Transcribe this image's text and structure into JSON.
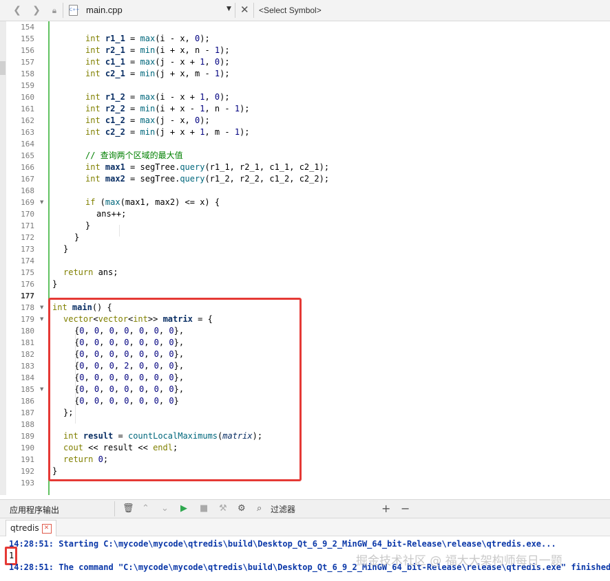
{
  "toolbar": {
    "back_icon": "back-arrow-icon",
    "forward_icon": "forward-arrow-icon",
    "lock_icon": "lock-icon",
    "file_icon": "cpp-file-icon",
    "file_name": "main.cpp",
    "symbol_placeholder": "<Select Symbol>"
  },
  "editor": {
    "lines": [
      {
        "n": "154",
        "fold": false
      },
      {
        "n": "155",
        "fold": false
      },
      {
        "n": "156",
        "fold": false
      },
      {
        "n": "157",
        "fold": false
      },
      {
        "n": "158",
        "fold": false
      },
      {
        "n": "159",
        "fold": false
      },
      {
        "n": "160",
        "fold": false
      },
      {
        "n": "161",
        "fold": false
      },
      {
        "n": "162",
        "fold": false
      },
      {
        "n": "163",
        "fold": false
      },
      {
        "n": "164",
        "fold": false
      },
      {
        "n": "165",
        "fold": false
      },
      {
        "n": "166",
        "fold": false
      },
      {
        "n": "167",
        "fold": false
      },
      {
        "n": "168",
        "fold": false
      },
      {
        "n": "169",
        "fold": true
      },
      {
        "n": "170",
        "fold": false
      },
      {
        "n": "171",
        "fold": false
      },
      {
        "n": "172",
        "fold": false
      },
      {
        "n": "173",
        "fold": false
      },
      {
        "n": "174",
        "fold": false
      },
      {
        "n": "175",
        "fold": false
      },
      {
        "n": "176",
        "fold": false
      },
      {
        "n": "177",
        "fold": false,
        "current": true
      },
      {
        "n": "178",
        "fold": true
      },
      {
        "n": "179",
        "fold": true
      },
      {
        "n": "180",
        "fold": false
      },
      {
        "n": "181",
        "fold": false
      },
      {
        "n": "182",
        "fold": false
      },
      {
        "n": "183",
        "fold": false
      },
      {
        "n": "184",
        "fold": false
      },
      {
        "n": "185",
        "fold": true
      },
      {
        "n": "186",
        "fold": false
      },
      {
        "n": "187",
        "fold": false
      },
      {
        "n": "188",
        "fold": false
      },
      {
        "n": "189",
        "fold": false
      },
      {
        "n": "190",
        "fold": false
      },
      {
        "n": "191",
        "fold": false
      },
      {
        "n": "192",
        "fold": false
      },
      {
        "n": "193",
        "fold": false
      }
    ],
    "code": [
      [],
      [
        [
          "kw",
          "int"
        ],
        [
          "t",
          " "
        ],
        [
          "var",
          "r1_1"
        ],
        [
          "t",
          " = "
        ],
        [
          "fn",
          "max"
        ],
        [
          "t",
          "(i - x, "
        ],
        [
          "num",
          "0"
        ],
        [
          "t",
          ");"
        ]
      ],
      [
        [
          "kw",
          "int"
        ],
        [
          "t",
          " "
        ],
        [
          "var",
          "r2_1"
        ],
        [
          "t",
          " = "
        ],
        [
          "fn",
          "min"
        ],
        [
          "t",
          "(i + x, n - "
        ],
        [
          "num",
          "1"
        ],
        [
          "t",
          ");"
        ]
      ],
      [
        [
          "kw",
          "int"
        ],
        [
          "t",
          " "
        ],
        [
          "var",
          "c1_1"
        ],
        [
          "t",
          " = "
        ],
        [
          "fn",
          "max"
        ],
        [
          "t",
          "(j - x + "
        ],
        [
          "num",
          "1"
        ],
        [
          "t",
          ", "
        ],
        [
          "num",
          "0"
        ],
        [
          "t",
          ");"
        ]
      ],
      [
        [
          "kw",
          "int"
        ],
        [
          "t",
          " "
        ],
        [
          "var",
          "c2_1"
        ],
        [
          "t",
          " = "
        ],
        [
          "fn",
          "min"
        ],
        [
          "t",
          "(j + x, m - "
        ],
        [
          "num",
          "1"
        ],
        [
          "t",
          ");"
        ]
      ],
      [],
      [
        [
          "kw",
          "int"
        ],
        [
          "t",
          " "
        ],
        [
          "var",
          "r1_2"
        ],
        [
          "t",
          " = "
        ],
        [
          "fn",
          "max"
        ],
        [
          "t",
          "(i - x + "
        ],
        [
          "num",
          "1"
        ],
        [
          "t",
          ", "
        ],
        [
          "num",
          "0"
        ],
        [
          "t",
          ");"
        ]
      ],
      [
        [
          "kw",
          "int"
        ],
        [
          "t",
          " "
        ],
        [
          "var",
          "r2_2"
        ],
        [
          "t",
          " = "
        ],
        [
          "fn",
          "min"
        ],
        [
          "t",
          "(i + x - "
        ],
        [
          "num",
          "1"
        ],
        [
          "t",
          ", n - "
        ],
        [
          "num",
          "1"
        ],
        [
          "t",
          ");"
        ]
      ],
      [
        [
          "kw",
          "int"
        ],
        [
          "t",
          " "
        ],
        [
          "var",
          "c1_2"
        ],
        [
          "t",
          " = "
        ],
        [
          "fn",
          "max"
        ],
        [
          "t",
          "(j - x, "
        ],
        [
          "num",
          "0"
        ],
        [
          "t",
          ");"
        ]
      ],
      [
        [
          "kw",
          "int"
        ],
        [
          "t",
          " "
        ],
        [
          "var",
          "c2_2"
        ],
        [
          "t",
          " = "
        ],
        [
          "fn",
          "min"
        ],
        [
          "t",
          "(j + x + "
        ],
        [
          "num",
          "1"
        ],
        [
          "t",
          ", m - "
        ],
        [
          "num",
          "1"
        ],
        [
          "t",
          ");"
        ]
      ],
      [],
      [
        [
          "cm",
          "// 查询两个区域的最大值"
        ]
      ],
      [
        [
          "kw",
          "int"
        ],
        [
          "t",
          " "
        ],
        [
          "var",
          "max1"
        ],
        [
          "t",
          " = segTree."
        ],
        [
          "fn",
          "query"
        ],
        [
          "t",
          "(r1_1, r2_1, c1_1, c2_1);"
        ]
      ],
      [
        [
          "kw",
          "int"
        ],
        [
          "t",
          " "
        ],
        [
          "var",
          "max2"
        ],
        [
          "t",
          " = segTree."
        ],
        [
          "fn",
          "query"
        ],
        [
          "t",
          "(r1_2, r2_2, c1_2, c2_2);"
        ]
      ],
      [],
      [
        [
          "kw",
          "if"
        ],
        [
          "t",
          " ("
        ],
        [
          "fn",
          "max"
        ],
        [
          "t",
          "(max1, max2) <= x) {"
        ]
      ],
      [
        [
          "t",
          "ans++;"
        ]
      ],
      [
        [
          "t",
          "}"
        ]
      ],
      [
        [
          "t",
          "}"
        ]
      ],
      [
        [
          "t",
          "}"
        ]
      ],
      [],
      [
        [
          "kw",
          "return"
        ],
        [
          "t",
          " ans;"
        ]
      ],
      [
        [
          "t",
          "}"
        ]
      ],
      [],
      [
        [
          "kw",
          "int"
        ],
        [
          "t",
          " "
        ],
        [
          "var",
          "main"
        ],
        [
          "t",
          "() {"
        ]
      ],
      [
        [
          "kw",
          "vector"
        ],
        [
          "t",
          "<"
        ],
        [
          "kw",
          "vector"
        ],
        [
          "t",
          "<"
        ],
        [
          "kw",
          "int"
        ],
        [
          "t",
          ">> "
        ],
        [
          "var",
          "matrix"
        ],
        [
          "t",
          " = {"
        ]
      ],
      [
        [
          "t",
          "{"
        ],
        [
          "num",
          "0"
        ],
        [
          "t",
          ", "
        ],
        [
          "num",
          "0"
        ],
        [
          "t",
          ", "
        ],
        [
          "num",
          "0"
        ],
        [
          "t",
          ", "
        ],
        [
          "num",
          "0"
        ],
        [
          "t",
          ", "
        ],
        [
          "num",
          "0"
        ],
        [
          "t",
          ", "
        ],
        [
          "num",
          "0"
        ],
        [
          "t",
          ", "
        ],
        [
          "num",
          "0"
        ],
        [
          "t",
          "},"
        ]
      ],
      [
        [
          "t",
          "{"
        ],
        [
          "num",
          "0"
        ],
        [
          "t",
          ", "
        ],
        [
          "num",
          "0"
        ],
        [
          "t",
          ", "
        ],
        [
          "num",
          "0"
        ],
        [
          "t",
          ", "
        ],
        [
          "num",
          "0"
        ],
        [
          "t",
          ", "
        ],
        [
          "num",
          "0"
        ],
        [
          "t",
          ", "
        ],
        [
          "num",
          "0"
        ],
        [
          "t",
          ", "
        ],
        [
          "num",
          "0"
        ],
        [
          "t",
          "},"
        ]
      ],
      [
        [
          "t",
          "{"
        ],
        [
          "num",
          "0"
        ],
        [
          "t",
          ", "
        ],
        [
          "num",
          "0"
        ],
        [
          "t",
          ", "
        ],
        [
          "num",
          "0"
        ],
        [
          "t",
          ", "
        ],
        [
          "num",
          "0"
        ],
        [
          "t",
          ", "
        ],
        [
          "num",
          "0"
        ],
        [
          "t",
          ", "
        ],
        [
          "num",
          "0"
        ],
        [
          "t",
          ", "
        ],
        [
          "num",
          "0"
        ],
        [
          "t",
          "},"
        ]
      ],
      [
        [
          "t",
          "{"
        ],
        [
          "num",
          "0"
        ],
        [
          "t",
          ", "
        ],
        [
          "num",
          "0"
        ],
        [
          "t",
          ", "
        ],
        [
          "num",
          "0"
        ],
        [
          "t",
          ", "
        ],
        [
          "num",
          "2"
        ],
        [
          "t",
          ", "
        ],
        [
          "num",
          "0"
        ],
        [
          "t",
          ", "
        ],
        [
          "num",
          "0"
        ],
        [
          "t",
          ", "
        ],
        [
          "num",
          "0"
        ],
        [
          "t",
          "},"
        ]
      ],
      [
        [
          "t",
          "{"
        ],
        [
          "num",
          "0"
        ],
        [
          "t",
          ", "
        ],
        [
          "num",
          "0"
        ],
        [
          "t",
          ", "
        ],
        [
          "num",
          "0"
        ],
        [
          "t",
          ", "
        ],
        [
          "num",
          "0"
        ],
        [
          "t",
          ", "
        ],
        [
          "num",
          "0"
        ],
        [
          "t",
          ", "
        ],
        [
          "num",
          "0"
        ],
        [
          "t",
          ", "
        ],
        [
          "num",
          "0"
        ],
        [
          "t",
          "},"
        ]
      ],
      [
        [
          "t",
          "{"
        ],
        [
          "num",
          "0"
        ],
        [
          "t",
          ", "
        ],
        [
          "num",
          "0"
        ],
        [
          "t",
          ", "
        ],
        [
          "num",
          "0"
        ],
        [
          "t",
          ", "
        ],
        [
          "num",
          "0"
        ],
        [
          "t",
          ", "
        ],
        [
          "num",
          "0"
        ],
        [
          "t",
          ", "
        ],
        [
          "num",
          "0"
        ],
        [
          "t",
          ", "
        ],
        [
          "num",
          "0"
        ],
        [
          "t",
          "},"
        ]
      ],
      [
        [
          "t",
          "{"
        ],
        [
          "num",
          "0"
        ],
        [
          "t",
          ", "
        ],
        [
          "num",
          "0"
        ],
        [
          "t",
          ", "
        ],
        [
          "num",
          "0"
        ],
        [
          "t",
          ", "
        ],
        [
          "num",
          "0"
        ],
        [
          "t",
          ", "
        ],
        [
          "num",
          "0"
        ],
        [
          "t",
          ", "
        ],
        [
          "num",
          "0"
        ],
        [
          "t",
          ", "
        ],
        [
          "num",
          "0"
        ],
        [
          "t",
          "}"
        ]
      ],
      [
        [
          "t",
          "};"
        ]
      ],
      [],
      [
        [
          "kw",
          "int"
        ],
        [
          "t",
          " "
        ],
        [
          "var",
          "result"
        ],
        [
          "t",
          " = "
        ],
        [
          "fn",
          "countLocalMaximums"
        ],
        [
          "t",
          "("
        ],
        [
          "it",
          "matrix"
        ],
        [
          "t",
          ");"
        ]
      ],
      [
        [
          "kw",
          "cout"
        ],
        [
          "t",
          " << result << "
        ],
        [
          "kw",
          "endl"
        ],
        [
          "t",
          ";"
        ]
      ],
      [
        [
          "kw",
          "return"
        ],
        [
          "t",
          " "
        ],
        [
          "num",
          "0"
        ],
        [
          "t",
          ";"
        ]
      ],
      [
        [
          "t",
          "}"
        ]
      ],
      []
    ]
  },
  "output_pane": {
    "title": "应用程序输出",
    "filter_label": "过滤器",
    "tab_label": "qtredis",
    "line1": "14:28:51: Starting C:\\mycode\\mycode\\qtredis\\build\\Desktop_Qt_6_9_2_MinGW_64_bit-Release\\release\\qtredis.exe...",
    "result": "1",
    "line3": "14:28:51: The command \"C:\\mycode\\mycode\\qtredis\\build\\Desktop_Qt_6_9_2_MinGW_64_bit-Release\\release\\qtredis.exe\" finished",
    "watermark": "掘金技术社区 @ 福大大架构师每日一题"
  },
  "colors": {
    "accent_red": "#e53935",
    "keyword": "#808000",
    "function": "#00677c",
    "number": "#000080",
    "comment": "#008000",
    "output_blue": "#0b38a8"
  }
}
